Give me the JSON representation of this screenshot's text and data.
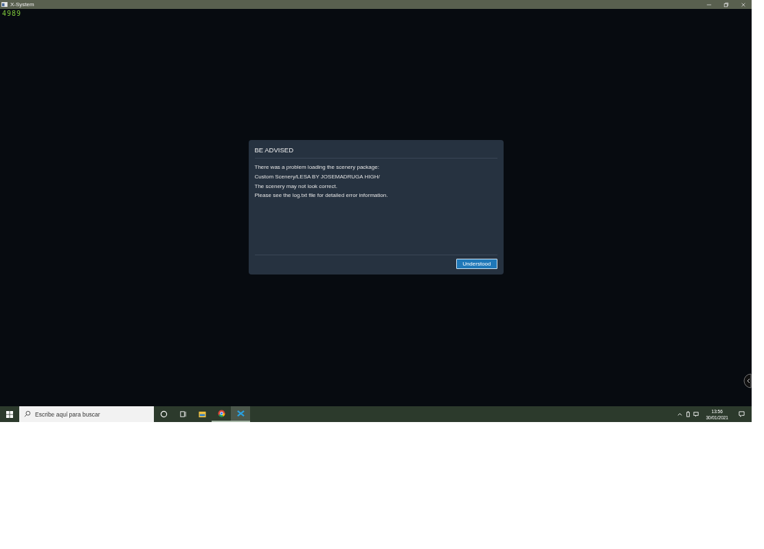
{
  "window": {
    "title": "X-System"
  },
  "frame_counter": "4989",
  "dialog": {
    "title": "BE ADVISED",
    "lines": [
      "There was a problem loading the scenery package:",
      "Custom Scenery/LESA BY JOSEMADRUGA HIGH/",
      "The scenery may not look correct.",
      "Please see the log.txt file for detailed error information."
    ],
    "button": "Understood"
  },
  "taskbar": {
    "search": {
      "placeholder": "Escribe aquí para buscar"
    },
    "apps": [
      {
        "kind": "cortana",
        "running": false,
        "selected": false
      },
      {
        "kind": "taskview",
        "running": false,
        "selected": false
      },
      {
        "kind": "explorer",
        "running": false,
        "selected": false
      },
      {
        "kind": "chrome",
        "running": true,
        "selected": false
      },
      {
        "kind": "xapp",
        "running": true,
        "selected": true
      }
    ],
    "time": "13:56",
    "date": "30/01/2021"
  }
}
